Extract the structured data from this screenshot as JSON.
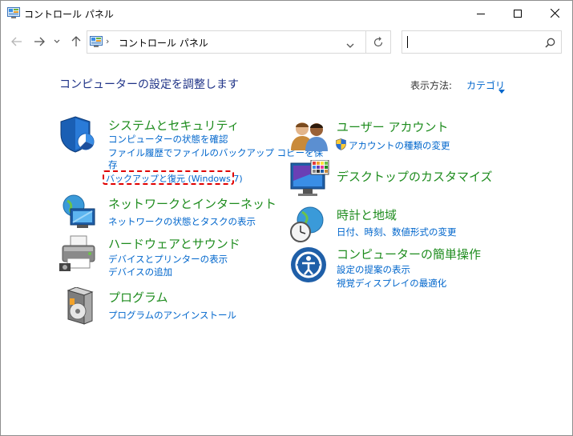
{
  "window": {
    "title": "コントロール パネル"
  },
  "navigation": {
    "breadcrumb_item": "コントロール パネル",
    "search_placeholder": ""
  },
  "header": {
    "title": "コンピューターの設定を調整します",
    "view_by_label": "表示方法:",
    "view_by_value": "カテゴリ"
  },
  "categories": {
    "system_security": {
      "title": "システムとセキュリティ",
      "links": [
        "コンピューターの状態を確認",
        "ファイル履歴でファイルのバックアップ コピーを保",
        "存",
        "バックアップと復元 (Windows 7)"
      ]
    },
    "network": {
      "title": "ネットワークとインターネット",
      "links": [
        "ネットワークの状態とタスクの表示"
      ]
    },
    "hardware": {
      "title": "ハードウェアとサウンド",
      "links": [
        "デバイスとプリンターの表示",
        "デバイスの追加"
      ]
    },
    "programs": {
      "title": "プログラム",
      "links": [
        "プログラムのアンインストール"
      ]
    },
    "user_accounts": {
      "title": "ユーザー アカウント",
      "links": [
        "アカウントの種類の変更"
      ]
    },
    "appearance": {
      "title": "デスクトップのカスタマイズ",
      "links": []
    },
    "clock_region": {
      "title": "時計と地域",
      "links": [
        "日付、時刻、数値形式の変更"
      ]
    },
    "ease_of_access": {
      "title": "コンピューターの簡単操作",
      "links": [
        "設定の提案の表示",
        "視覚ディスプレイの最適化"
      ]
    }
  },
  "colors": {
    "link": "#0066cc",
    "category_title": "#1e8c1e",
    "header": "#1e3287",
    "highlight": "#e00000"
  }
}
